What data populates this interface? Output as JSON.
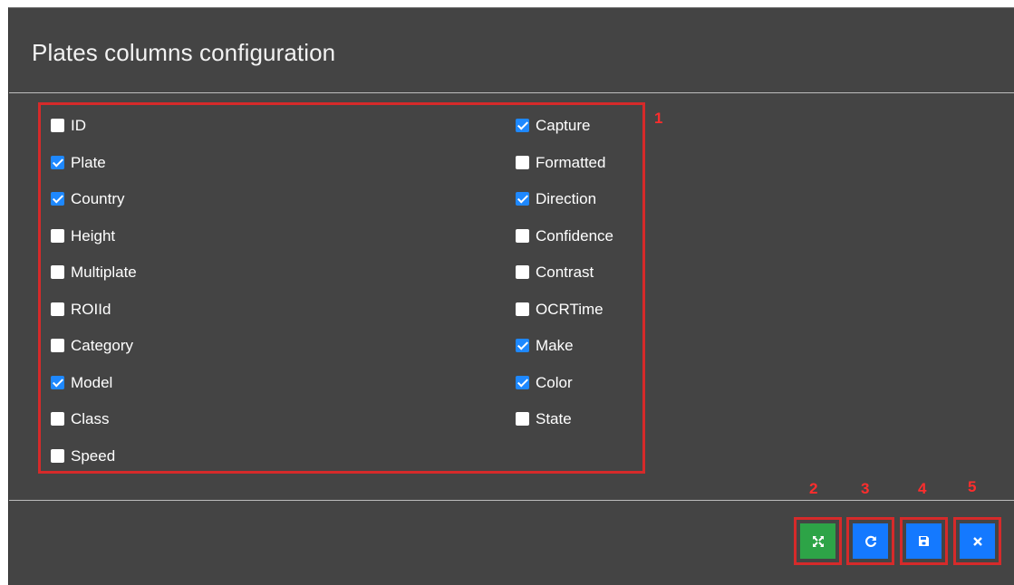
{
  "dialog": {
    "title": "Plates columns configuration"
  },
  "columns": {
    "left": [
      {
        "label": "ID",
        "checked": false
      },
      {
        "label": "Plate",
        "checked": true
      },
      {
        "label": "Country",
        "checked": true
      },
      {
        "label": "Height",
        "checked": false
      },
      {
        "label": "Multiplate",
        "checked": false
      },
      {
        "label": "ROIId",
        "checked": false
      },
      {
        "label": "Category",
        "checked": false
      },
      {
        "label": "Model",
        "checked": true
      },
      {
        "label": "Class",
        "checked": false
      },
      {
        "label": "Speed",
        "checked": false
      }
    ],
    "right": [
      {
        "label": "Capture",
        "checked": true
      },
      {
        "label": "Formatted",
        "checked": false
      },
      {
        "label": "Direction",
        "checked": true
      },
      {
        "label": "Confidence",
        "checked": false
      },
      {
        "label": "Contrast",
        "checked": false
      },
      {
        "label": "OCRTime",
        "checked": false
      },
      {
        "label": "Make",
        "checked": true
      },
      {
        "label": "Color",
        "checked": true
      },
      {
        "label": "State",
        "checked": false
      }
    ]
  },
  "markers": {
    "m1": "1",
    "m2": "2",
    "m3": "3",
    "m4": "4",
    "m5": "5"
  },
  "buttons": {
    "expand": {
      "icon": "expand-icon",
      "color": "#2da447"
    },
    "reset": {
      "icon": "refresh-icon",
      "color": "#1479ff"
    },
    "save": {
      "icon": "save-icon",
      "color": "#1479ff"
    },
    "close": {
      "icon": "close-icon",
      "color": "#1479ff"
    }
  },
  "colors": {
    "background": "#444444",
    "annotation": "#d62a2a",
    "checked": "#1e88ff"
  }
}
